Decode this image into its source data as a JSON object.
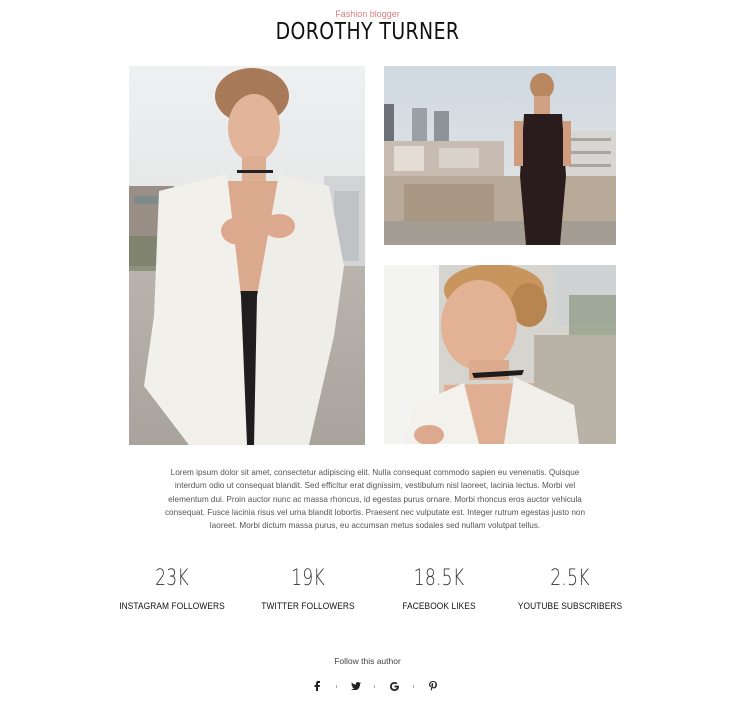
{
  "header": {
    "subtitle": "Fashion blogger",
    "name": "DOROTHY TURNER"
  },
  "bio": "Lorem ipsum dolor sit amet, consectetur adipiscing elit. Nulla consequat commodo sapien eu venenatis. Quisque interdum odio ut consequat blandit. Sed efficitur erat dignissim, vestibulum nisl laoreet, lacinia lectus. Morbi vel elementum dui. Proin auctor nunc ac massa rhoncus, id egestas purus ornare. Morbi rhoncus eros auctor vehicula consequat. Fusce lacinia risus vel urna blandit lobortis. Praesent nec vulputate est. Integer rutrum egestas justo non laoreet. Morbi dictum massa purus, eu accumsan metus sodales sed nullam volutpat tellus.",
  "stats": [
    {
      "value": "23K",
      "label": "INSTAGRAM FOLLOWERS"
    },
    {
      "value": "19K",
      "label": "TWITTER FOLLOWERS"
    },
    {
      "value": "18.5K",
      "label": "FACEBOOK LIKES"
    },
    {
      "value": "2.5K",
      "label": "YOUTUBE SUBSCRIBERS"
    }
  ],
  "follow": {
    "label": "Follow this author",
    "icons": [
      "facebook-icon",
      "twitter-icon",
      "google-icon",
      "pinterest-icon"
    ]
  },
  "colors": {
    "accent": "#d98080",
    "text_dark": "#111111",
    "text_body": "#555555"
  }
}
